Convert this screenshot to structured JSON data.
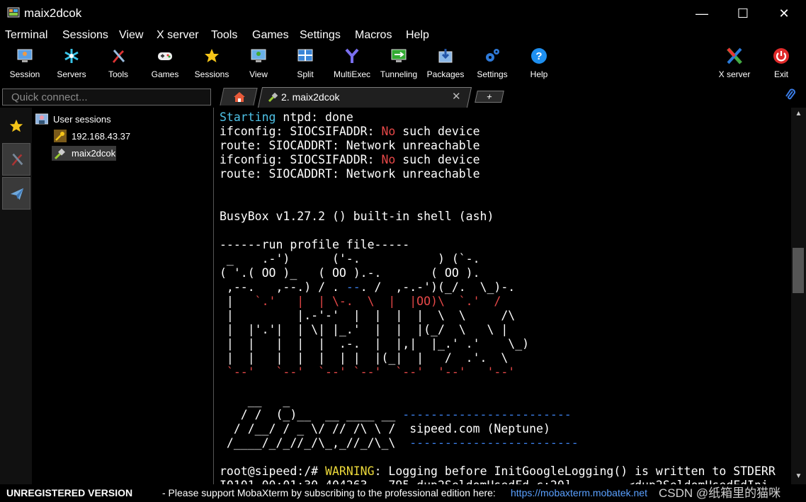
{
  "window": {
    "title": "maix2dcok",
    "minimize": "—",
    "maximize": "☐",
    "close": "✕"
  },
  "menu": [
    "Terminal",
    "Sessions",
    "View",
    "X server",
    "Tools",
    "Games",
    "Settings",
    "Macros",
    "Help"
  ],
  "toolbar": {
    "items": [
      {
        "label": "Session",
        "icon": "session-icon"
      },
      {
        "label": "Servers",
        "icon": "servers-icon"
      },
      {
        "label": "Tools",
        "icon": "tools-icon"
      },
      {
        "label": "Games",
        "icon": "games-icon"
      },
      {
        "label": "Sessions",
        "icon": "sessions-star-icon"
      },
      {
        "label": "View",
        "icon": "view-icon"
      },
      {
        "label": "Split",
        "icon": "split-icon"
      },
      {
        "label": "MultiExec",
        "icon": "multiexec-icon"
      },
      {
        "label": "Tunneling",
        "icon": "tunneling-icon"
      },
      {
        "label": "Packages",
        "icon": "packages-icon"
      },
      {
        "label": "Settings",
        "icon": "settings-icon"
      },
      {
        "label": "Help",
        "icon": "help-icon"
      }
    ],
    "right": [
      {
        "label": "X server",
        "icon": "xserver-icon"
      },
      {
        "label": "Exit",
        "icon": "exit-icon"
      }
    ]
  },
  "quick_connect": {
    "placeholder": "Quick connect..."
  },
  "tabs": {
    "active_label": "2. maix2dcok",
    "new_tab": "+"
  },
  "sessions_tree": {
    "root": "User sessions",
    "items": [
      "192.168.43.37",
      "maix2dcok"
    ]
  },
  "terminal": {
    "lines": [
      [
        [
          "Starting",
          "cyan"
        ],
        [
          " ntpd: done",
          ""
        ]
      ],
      [
        [
          "ifconfig: SIOCSIFADDR: ",
          ""
        ],
        [
          "No",
          "red"
        ],
        [
          " such device",
          ""
        ]
      ],
      [
        [
          "route: SIOCADDRT: Network unreachable",
          ""
        ]
      ],
      [
        [
          "ifconfig: SIOCSIFADDR: ",
          ""
        ],
        [
          "No",
          "red"
        ],
        [
          " such device",
          ""
        ]
      ],
      [
        [
          "route: SIOCADDRT: Network unreachable",
          ""
        ]
      ],
      [
        [
          "",
          ""
        ]
      ],
      [
        [
          "",
          ""
        ]
      ],
      [
        [
          "BusyBox v1.27.2 () built-in shell (ash)",
          ""
        ]
      ],
      [
        [
          "",
          ""
        ]
      ],
      [
        [
          "------run profile file-----",
          ""
        ]
      ],
      [
        [
          " _    .-')      ('-.           ) (`-.",
          ""
        ]
      ],
      [
        [
          "( '.( OO )_   ( OO ).-.       ( OO ).",
          ""
        ]
      ],
      [
        [
          " ,--.   ,--.) / . ",
          ""
        ],
        [
          "--",
          "blue"
        ],
        [
          ". /  ,-.-')(_/.  \\_)-.",
          ""
        ]
      ],
      [
        [
          " |   ",
          ""
        ],
        [
          "`.'   |  | \\-.  \\  |  |OO)\\  `.'  /",
          "red"
        ]
      ],
      [
        [
          " |         |.-'-'  |  |  |  |  \\  \\     /\\",
          ""
        ]
      ],
      [
        [
          " |  |'.'|  | \\| |_.'  |  |  |(_/  \\   \\ |",
          ""
        ]
      ],
      [
        [
          " |  |   |  |  |  .-.  |  |,|  |_.' .'    \\_)",
          ""
        ]
      ],
      [
        [
          " |  |   |  |  |  | |  |(_|  |   /  .'.  \\",
          ""
        ]
      ],
      [
        [
          " ",
          ""
        ],
        [
          "`--'   `--'  `--' `--'  `--'  '--'   '--'",
          "red"
        ]
      ],
      [
        [
          "",
          ""
        ]
      ],
      [
        [
          "    __   _",
          ""
        ]
      ],
      [
        [
          "   / /  (_)__  __ ____ __ ",
          ""
        ],
        [
          "------------------------",
          "blue"
        ]
      ],
      [
        [
          "  / /__/ / _ \\/ // /\\ \\ /  sipeed.com (Neptune)",
          ""
        ]
      ],
      [
        [
          " /____/_/_//_/\\_,_//_/\\_\\  ",
          ""
        ],
        [
          "------------------------",
          "blue"
        ]
      ],
      [
        [
          "",
          ""
        ]
      ],
      [
        [
          "root@sipeed:/# ",
          ""
        ],
        [
          "WARNING",
          "yel"
        ],
        [
          ": Logging before InitGoogleLogging() is written to STDERR",
          ""
        ]
      ],
      [
        [
          "I0101 00:01:30.404263   795 dup2SeldomUsedFd.c:20]        <dup2SeldomUsedFdIni",
          ""
        ]
      ]
    ]
  },
  "status": {
    "unregistered": "UNREGISTERED VERSION",
    "message": "-  Please support MobaXterm by subscribing to the professional edition here:",
    "link": "https://mobaxterm.mobatek.net",
    "watermark": "CSDN @纸箱里的猫咪"
  },
  "colors": {
    "terminal_cyan": "#4fc3e8",
    "terminal_red": "#e64848",
    "terminal_yellow": "#ecd93a",
    "link": "#5aa0ff"
  }
}
